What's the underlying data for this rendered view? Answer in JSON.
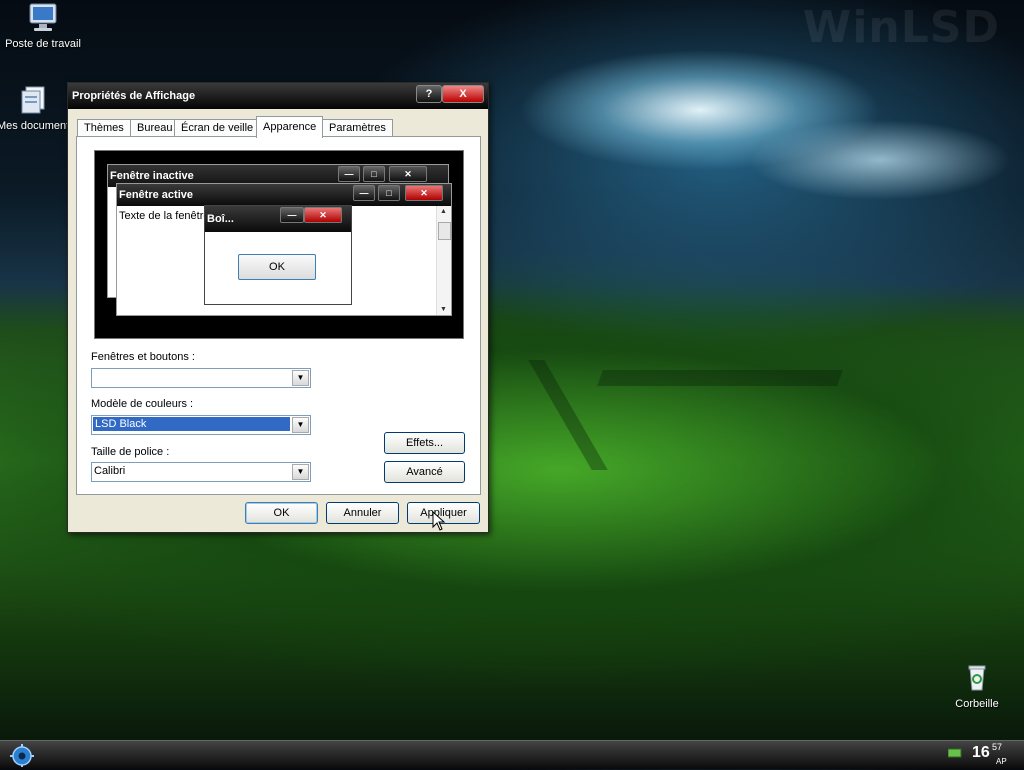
{
  "desktop": {
    "watermark": "WinLSD",
    "icons": [
      {
        "label": "Poste de travail"
      },
      {
        "label": "Mes documents"
      },
      {
        "label": "Corbeille"
      }
    ]
  },
  "dialog": {
    "title": "Propriétés de Affichage",
    "help_label": "?",
    "close_label": "X",
    "tabs": [
      {
        "label": "Thèmes"
      },
      {
        "label": "Bureau"
      },
      {
        "label": "Écran de veille"
      },
      {
        "label": "Apparence"
      },
      {
        "label": "Paramètres"
      }
    ],
    "active_tab": "Apparence",
    "preview": {
      "inactive_title": "Fenêtre inactive",
      "active_title": "Fenêtre active",
      "window_text": "Texte de la fenêtre",
      "msgbox_title": "Boî...",
      "msgbox_ok": "OK"
    },
    "fields": {
      "windows_buttons_label": "Fenêtres et boutons :",
      "windows_buttons_value": "",
      "color_scheme_label": "Modèle de couleurs :",
      "color_scheme_value": "LSD Black",
      "font_size_label": "Taille de police :",
      "font_size_value": "Calibri"
    },
    "buttons": {
      "effects": "Effets...",
      "advanced": "Avancé",
      "ok": "OK",
      "cancel": "Annuler",
      "apply": "Appliquer"
    }
  },
  "taskbar": {
    "clock_hour": "16",
    "clock_minute": "57",
    "clock_ampm": "AP"
  },
  "colors": {
    "titlebar": "#0a0a0a",
    "selection": "#316ac5",
    "close_button": "#c00000"
  }
}
